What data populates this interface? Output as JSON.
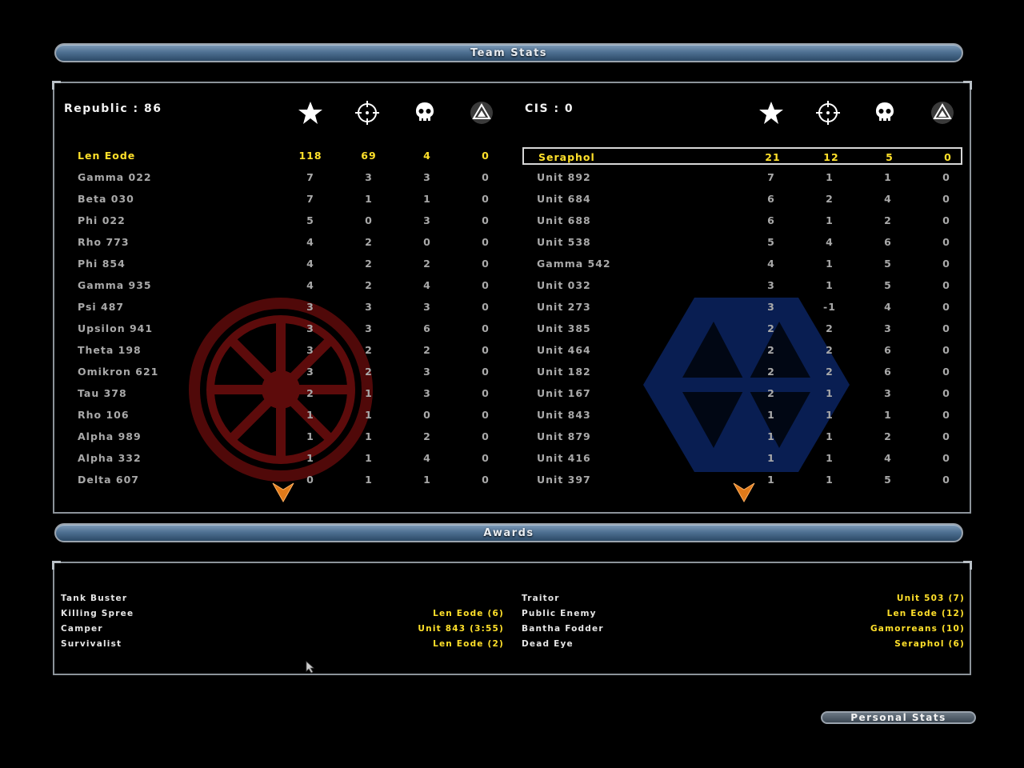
{
  "headers": {
    "team_stats": "Team Stats",
    "awards": "Awards"
  },
  "republic": {
    "title": "Republic : 86",
    "players": [
      {
        "name": "Len Eode",
        "points": "118",
        "kills": "69",
        "deaths": "4",
        "cp": "0"
      },
      {
        "name": "Gamma 022",
        "points": "7",
        "kills": "3",
        "deaths": "3",
        "cp": "0"
      },
      {
        "name": "Beta 030",
        "points": "7",
        "kills": "1",
        "deaths": "1",
        "cp": "0"
      },
      {
        "name": "Phi 022",
        "points": "5",
        "kills": "0",
        "deaths": "3",
        "cp": "0"
      },
      {
        "name": "Rho 773",
        "points": "4",
        "kills": "2",
        "deaths": "0",
        "cp": "0"
      },
      {
        "name": "Phi 854",
        "points": "4",
        "kills": "2",
        "deaths": "2",
        "cp": "0"
      },
      {
        "name": "Gamma 935",
        "points": "4",
        "kills": "2",
        "deaths": "4",
        "cp": "0"
      },
      {
        "name": "Psi 487",
        "points": "3",
        "kills": "3",
        "deaths": "3",
        "cp": "0"
      },
      {
        "name": "Upsilon 941",
        "points": "3",
        "kills": "3",
        "deaths": "6",
        "cp": "0"
      },
      {
        "name": "Theta 198",
        "points": "3",
        "kills": "2",
        "deaths": "2",
        "cp": "0"
      },
      {
        "name": "Omikron 621",
        "points": "3",
        "kills": "2",
        "deaths": "3",
        "cp": "0"
      },
      {
        "name": "Tau 378",
        "points": "2",
        "kills": "1",
        "deaths": "3",
        "cp": "0"
      },
      {
        "name": "Rho 106",
        "points": "1",
        "kills": "1",
        "deaths": "0",
        "cp": "0"
      },
      {
        "name": "Alpha 989",
        "points": "1",
        "kills": "1",
        "deaths": "2",
        "cp": "0"
      },
      {
        "name": "Alpha 332",
        "points": "1",
        "kills": "1",
        "deaths": "4",
        "cp": "0"
      },
      {
        "name": "Delta 607",
        "points": "0",
        "kills": "1",
        "deaths": "1",
        "cp": "0"
      }
    ]
  },
  "cis": {
    "title": "CIS : 0",
    "players": [
      {
        "name": "Seraphol",
        "points": "21",
        "kills": "12",
        "deaths": "5",
        "cp": "0"
      },
      {
        "name": "Unit 892",
        "points": "7",
        "kills": "1",
        "deaths": "1",
        "cp": "0"
      },
      {
        "name": "Unit 684",
        "points": "6",
        "kills": "2",
        "deaths": "4",
        "cp": "0"
      },
      {
        "name": "Unit 688",
        "points": "6",
        "kills": "1",
        "deaths": "2",
        "cp": "0"
      },
      {
        "name": "Unit 538",
        "points": "5",
        "kills": "4",
        "deaths": "6",
        "cp": "0"
      },
      {
        "name": "Gamma 542",
        "points": "4",
        "kills": "1",
        "deaths": "5",
        "cp": "0"
      },
      {
        "name": "Unit 032",
        "points": "3",
        "kills": "1",
        "deaths": "5",
        "cp": "0"
      },
      {
        "name": "Unit 273",
        "points": "3",
        "kills": "-1",
        "deaths": "4",
        "cp": "0"
      },
      {
        "name": "Unit 385",
        "points": "2",
        "kills": "2",
        "deaths": "3",
        "cp": "0"
      },
      {
        "name": "Unit 464",
        "points": "2",
        "kills": "2",
        "deaths": "6",
        "cp": "0"
      },
      {
        "name": "Unit 182",
        "points": "2",
        "kills": "2",
        "deaths": "6",
        "cp": "0"
      },
      {
        "name": "Unit 167",
        "points": "2",
        "kills": "1",
        "deaths": "3",
        "cp": "0"
      },
      {
        "name": "Unit 843",
        "points": "1",
        "kills": "1",
        "deaths": "1",
        "cp": "0"
      },
      {
        "name": "Unit 879",
        "points": "1",
        "kills": "1",
        "deaths": "2",
        "cp": "0"
      },
      {
        "name": "Unit 416",
        "points": "1",
        "kills": "1",
        "deaths": "4",
        "cp": "0"
      },
      {
        "name": "Unit 397",
        "points": "1",
        "kills": "1",
        "deaths": "5",
        "cp": "0"
      }
    ]
  },
  "column_icons": [
    "star-icon",
    "crosshair-icon",
    "skull-icon",
    "command-post-icon"
  ],
  "awards": {
    "left": [
      {
        "label": "Tank Buster",
        "value": ""
      },
      {
        "label": "Killing Spree",
        "value": "Len Eode (6)"
      },
      {
        "label": "Camper",
        "value": "Unit 843 (3:55)"
      },
      {
        "label": "Survivalist",
        "value": "Len Eode (2)"
      }
    ],
    "right": [
      {
        "label": "Traitor",
        "value": "Unit 503 (7)"
      },
      {
        "label": "Public Enemy",
        "value": "Len Eode (12)"
      },
      {
        "label": "Bantha Fodder",
        "value": "Gamorreans (10)"
      },
      {
        "label": "Dead Eye",
        "value": "Seraphol (6)"
      }
    ]
  },
  "buttons": {
    "personal_stats": "Personal Stats"
  },
  "colors": {
    "highlight": "#ffe02a",
    "republic_emblem": "#7a0d0d",
    "cis_emblem": "#0d2a6e",
    "header_blue": "#4f7193"
  }
}
